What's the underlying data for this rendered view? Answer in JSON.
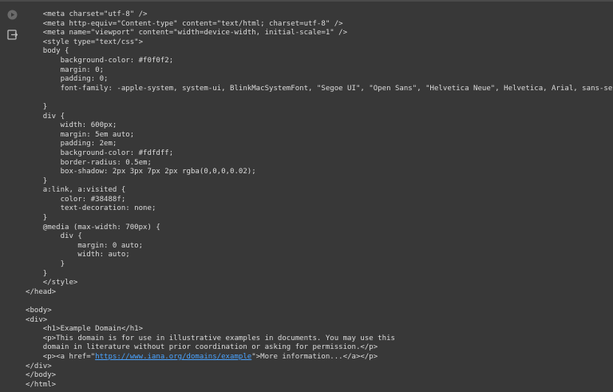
{
  "toolbar": {
    "run_icon": "play-circle-icon",
    "output_icon": "output-export-icon"
  },
  "code_lines": [
    "    <meta charset=\"utf-8\" />",
    "    <meta http-equiv=\"Content-type\" content=\"text/html; charset=utf-8\" />",
    "    <meta name=\"viewport\" content=\"width=device-width, initial-scale=1\" />",
    "    <style type=\"text/css\">",
    "    body {",
    "        background-color: #f0f0f2;",
    "        margin: 0;",
    "        padding: 0;",
    "        font-family: -apple-system, system-ui, BlinkMacSystemFont, \"Segoe UI\", \"Open Sans\", \"Helvetica Neue\", Helvetica, Arial, sans-serif;",
    "",
    "    }",
    "    div {",
    "        width: 600px;",
    "        margin: 5em auto;",
    "        padding: 2em;",
    "        background-color: #fdfdff;",
    "        border-radius: 0.5em;",
    "        box-shadow: 2px 3px 7px 2px rgba(0,0,0,0.02);",
    "    }",
    "    a:link, a:visited {",
    "        color: #38488f;",
    "        text-decoration: none;",
    "    }",
    "    @media (max-width: 700px) {",
    "        div {",
    "            margin: 0 auto;",
    "            width: auto;",
    "        }",
    "    }",
    "    </style>",
    "</head>",
    "",
    "<body>",
    "<div>",
    "    <h1>Example Domain</h1>",
    "    <p>This domain is for use in illustrative examples in documents. You may use this",
    "    domain in literature without prior coordination or asking for permission.</p>",
    "    <p><a href=\"",
    "</div>",
    "</body>",
    "</html>"
  ],
  "link_line": {
    "prefix": "    <p><a href=\"",
    "url": "https://www.iana.org/domains/example",
    "suffix": "\">More information...</a></p>"
  }
}
